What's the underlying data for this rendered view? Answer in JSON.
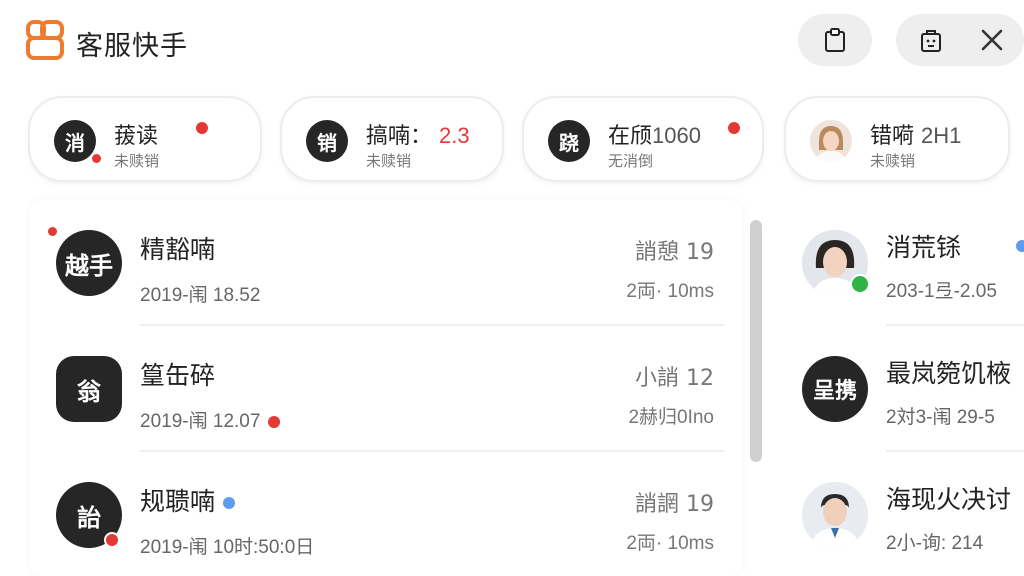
{
  "app": {
    "title": "客服快手"
  },
  "header": {
    "clipboard_icon": "clipboard-icon",
    "bag_icon": "bag-icon",
    "close_icon": "close-icon"
  },
  "chips": [
    {
      "avatar": "消",
      "name": "菝读",
      "number": "",
      "sub": "未赎销",
      "photo": false
    },
    {
      "avatar": "销",
      "name": "搞喃：",
      "number": "2.3",
      "sub": "未赎销",
      "photo": false
    },
    {
      "avatar": "跷",
      "name": "在颀",
      "number": "1060",
      "sub": "无消倒",
      "photo": false
    },
    {
      "avatar": "",
      "name": "错嗬",
      "number": "2H1",
      "sub": "未赎销",
      "photo": true
    }
  ],
  "conversations": [
    {
      "avatar": "越手",
      "name": "精豁喃",
      "time": "2019-闱 18.52",
      "tag": "誚憩 19",
      "meta": "2両· 10ms",
      "square": false
    },
    {
      "avatar": "翁",
      "name": "篁缶碎",
      "time": "2019-闱 12.07",
      "tag": "小誚 12",
      "meta": "2赫归0Ino",
      "square": true
    },
    {
      "avatar": "詒",
      "name": "规聩喃",
      "time": "2019-闱 10时:50:0日",
      "tag": "誚誷 19",
      "meta": "2両· 10ms",
      "square": false
    }
  ],
  "right_conversations": [
    {
      "avatar": "",
      "name": "消荒铩",
      "time": "203-1弖-2.05",
      "photo": true,
      "verified": true
    },
    {
      "avatar": "呈携",
      "name": "最岚箢饥棭",
      "time": "2対3-闱 29-5",
      "photo": false,
      "verified": false
    },
    {
      "avatar": "",
      "name": "海现火决讨",
      "time": "2小-询: 214",
      "photo": true,
      "verified": false
    }
  ],
  "colors": {
    "brand": "#f07a2e",
    "unread_red": "#e53935",
    "status_blue": "#5b9bf0",
    "verified_green": "#2fb344"
  }
}
